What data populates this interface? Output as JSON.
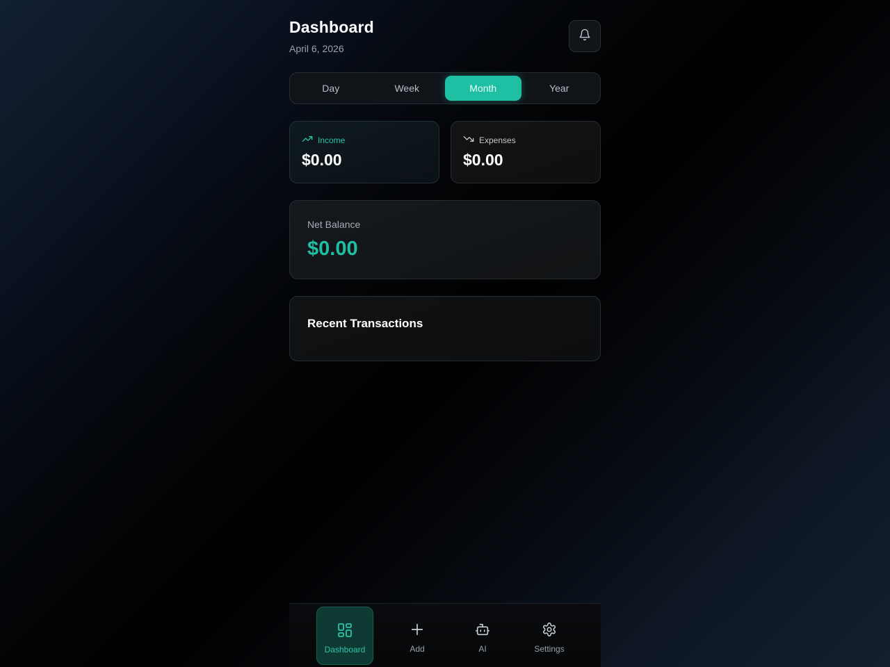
{
  "header": {
    "title": "Dashboard",
    "date": "April 6, 2026",
    "notifications_icon": "bell-icon"
  },
  "period_tabs": {
    "options": [
      "Day",
      "Week",
      "Month",
      "Year"
    ],
    "selected": "Month"
  },
  "summary": {
    "income": {
      "label": "Income",
      "value": "$0.00",
      "icon": "trending-up-icon"
    },
    "expenses": {
      "label": "Expenses",
      "value": "$0.00",
      "icon": "trending-down-icon"
    }
  },
  "balance": {
    "label": "Net Balance",
    "value": "$0.00"
  },
  "recent_transactions": {
    "title": "Recent Transactions"
  },
  "bottom_nav": {
    "items": [
      {
        "label": "Dashboard",
        "icon": "grid-icon",
        "active": true
      },
      {
        "label": "Add",
        "icon": "plus-icon",
        "active": false
      },
      {
        "label": "AI",
        "icon": "robot-icon",
        "active": false
      },
      {
        "label": "Settings",
        "icon": "gear-icon",
        "active": false
      }
    ]
  },
  "colors": {
    "accent": "#1fbfa3",
    "background": "#000000",
    "card": "#111315"
  }
}
